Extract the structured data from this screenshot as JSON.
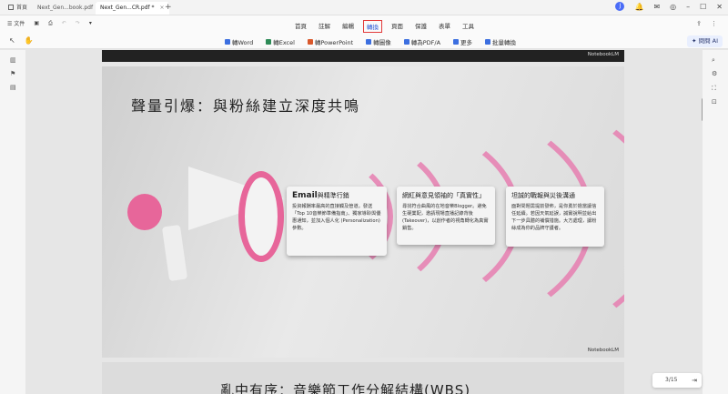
{
  "titlebar": {
    "home": "首頁",
    "tabs": [
      {
        "label": "Next_Gen...book.pdf",
        "active": false
      },
      {
        "label": "Next_Gen...CR.pdf *",
        "active": true
      }
    ],
    "new_tab": "+",
    "avatar_letter": "J"
  },
  "menubar": {
    "file_label": "文件",
    "items": [
      "首頁",
      "註解",
      "編輯",
      "轉換",
      "頁面",
      "保護",
      "表單",
      "工具"
    ],
    "selected": "轉換"
  },
  "toolbar": {
    "actions": [
      {
        "label": "轉Word"
      },
      {
        "label": "轉Excel"
      },
      {
        "label": "轉PowerPoint"
      },
      {
        "label": "轉圖像"
      },
      {
        "label": "轉為PDF/A"
      },
      {
        "label": "更多"
      },
      {
        "label": "批量轉換"
      }
    ],
    "ask_ai": "問問 AI"
  },
  "document": {
    "watermark": "NotebookLM",
    "slide_title": "聲量引爆：與粉絲建立深度共鳴",
    "cards": [
      {
        "title_bold": "Email",
        "title_rest": "與精準行銷",
        "body": "投資報酬率最高的直接觸及管道。發送「Top 10音樂節準備指南」、獨家導聆與優惠通知，並加入個人化 (Personalization)參數。"
      },
      {
        "title_bold": "",
        "title_rest": "網紅與意見領袖的「真實性」",
        "body": "尋找符合曲風的在地音樂Blogger。避免生硬業配，邀請現場直播記錄背後(Takeover)，以創作者的視角轉化為真實銷售。"
      },
      {
        "title_bold": "",
        "title_rest": "坦誠的戰報與災後溝通",
        "body": "面對問題需提前發佈，是你勇於擔當讓信任延續。若因天氣延誤，誠實說明並給出下一步具體的補償措施。大方處理，讓粉絲成為你的品牌守護者。"
      }
    ],
    "next_slide_title": "亂中有序：音樂節工作分解結構(WBS)"
  },
  "pager": {
    "text": "3/15"
  }
}
